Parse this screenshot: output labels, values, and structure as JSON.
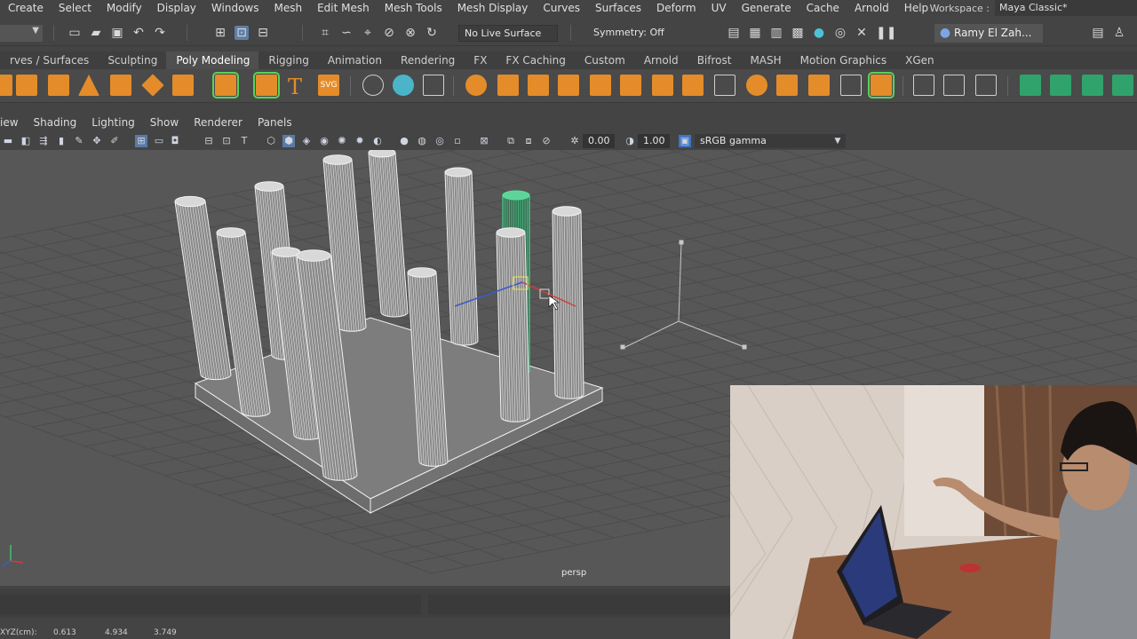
{
  "menubar": {
    "items": [
      "Create",
      "Select",
      "Modify",
      "Display",
      "Windows",
      "Mesh",
      "Edit Mesh",
      "Mesh Tools",
      "Mesh Display",
      "Curves",
      "Surfaces",
      "Deform",
      "UV",
      "Generate",
      "Cache",
      "Arnold",
      "Help"
    ],
    "workspace_label": "Workspace :",
    "workspace_value": "Maya Classic*"
  },
  "statusline": {
    "live_surface": "No Live Surface",
    "symmetry": "Symmetry: Off",
    "user": "Ramy El Zah..."
  },
  "shelf_tabs": {
    "items": [
      "rves / Surfaces",
      "Sculpting",
      "Poly Modeling",
      "Rigging",
      "Animation",
      "Rendering",
      "FX",
      "FX Caching",
      "Custom",
      "Arnold",
      "Bifrost",
      "MASH",
      "Motion Graphics",
      "XGen"
    ],
    "active": "Poly Modeling"
  },
  "panel_menu": {
    "items": [
      "iew",
      "Shading",
      "Lighting",
      "Show",
      "Renderer",
      "Panels"
    ]
  },
  "panel_toolbar": {
    "exposure": "0.00",
    "gamma": "1.00",
    "color_space": "sRGB gamma"
  },
  "viewport": {
    "camera": "persp"
  },
  "coords": {
    "label": "XYZ(cm):",
    "x": "0.613",
    "y": "4.934",
    "z": "3.749"
  },
  "colors": {
    "selection_green": "#4be89b",
    "shelf_orange": "#e48c2a"
  }
}
